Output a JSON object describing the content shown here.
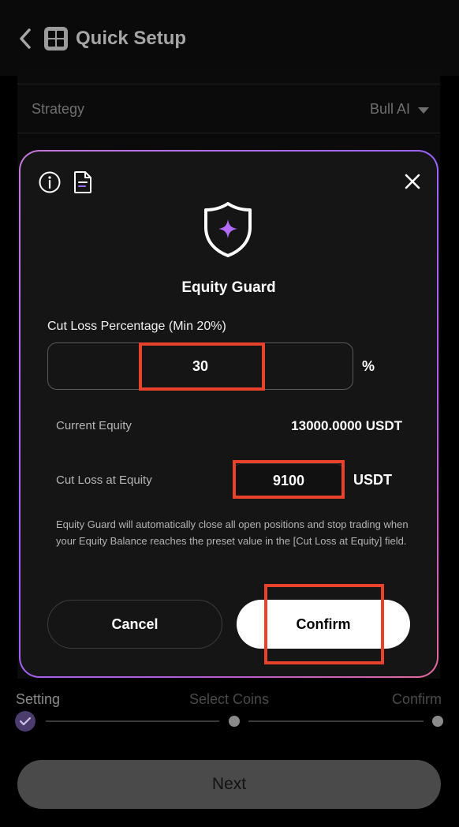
{
  "header": {
    "title": "Quick Setup"
  },
  "settings": {
    "strategy_label": "Strategy",
    "strategy_value": "Bull AI"
  },
  "steps": {
    "items": [
      {
        "label": "Setting",
        "done": true
      },
      {
        "label": "Select Coins",
        "done": false
      },
      {
        "label": "Confirm",
        "done": false
      }
    ]
  },
  "footer": {
    "next_label": "Next"
  },
  "modal": {
    "title": "Equity Guard",
    "cut_loss_pct_label": "Cut Loss Percentage (Min 20%)",
    "cut_loss_pct_value": "30",
    "pct_unit": "%",
    "current_equity_label": "Current Equity",
    "current_equity_value": "13000.0000 USDT",
    "cut_loss_equity_label": "Cut Loss at Equity",
    "cut_loss_equity_value": "9100",
    "equity_unit": "USDT",
    "description": "Equity Guard will automatically close all open positions and stop trading when your Equity Balance reaches the preset value in the [Cut Loss at Equity] field.",
    "cancel_label": "Cancel",
    "confirm_label": "Confirm"
  },
  "icons": {
    "back": "chevron-left-icon",
    "app": "app-logo-icon",
    "info": "info-icon",
    "document": "document-icon",
    "close": "close-icon",
    "shield": "shield-sparkle-icon",
    "step_done": "check-icon"
  },
  "colors": {
    "modal_gradient_start": "#c678d9",
    "modal_gradient_end": "#e4689c",
    "sparkle": "#b36bff",
    "annotation": "#e8412c",
    "confirm_bg": "#ffffff"
  }
}
